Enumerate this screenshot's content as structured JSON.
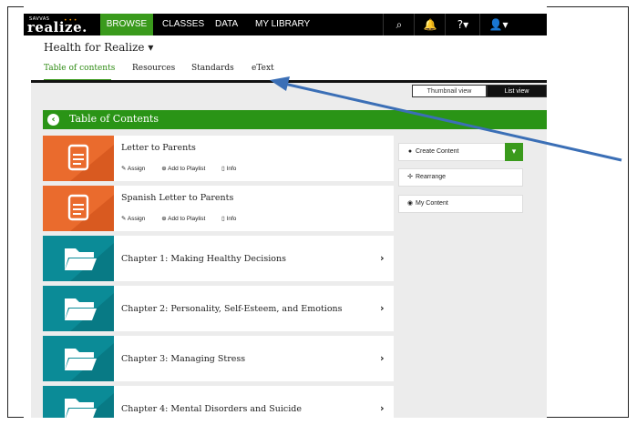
{
  "nav": {
    "logo_small": "SAVVAS",
    "logo_big": "realize.",
    "tabs": [
      "BROWSE",
      "CLASSES",
      "DATA",
      "MY LIBRARY"
    ],
    "icons": [
      "search-icon",
      "bell-icon",
      "help-icon",
      "user-icon"
    ],
    "icon_glyphs": [
      "⌕",
      "🔔",
      "?▾",
      "👤▾"
    ]
  },
  "program": {
    "title": "Health for Realize ▾"
  },
  "subtabs": [
    "Table of contents",
    "Resources",
    "Standards",
    "eText"
  ],
  "views": {
    "thumbnail": "Thumbnail view",
    "list": "List view"
  },
  "toc": {
    "title": "Table of Contents"
  },
  "items": [
    {
      "title": "Letter to Parents",
      "kind": "document",
      "actions": [
        "Assign",
        "Add to Playlist",
        "Info"
      ]
    },
    {
      "title": "Spanish Letter to Parents",
      "kind": "document",
      "actions": [
        "Assign",
        "Add to Playlist",
        "Info"
      ]
    },
    {
      "title": "Chapter 1: Making Healthy Decisions",
      "kind": "folder"
    },
    {
      "title": "Chapter 2: Personality, Self-Esteem, and Emotions",
      "kind": "folder"
    },
    {
      "title": "Chapter 3: Managing Stress",
      "kind": "folder"
    },
    {
      "title": "Chapter 4: Mental Disorders and Suicide",
      "kind": "folder"
    }
  ],
  "side": {
    "create": "Create Content",
    "rearrange": "Rearrange",
    "mycontent": "My Content"
  },
  "colors": {
    "green": "#3a9a1c",
    "orange": "#ea6b2d",
    "teal": "#0b8b97",
    "arrow": "#3b6fb6"
  }
}
